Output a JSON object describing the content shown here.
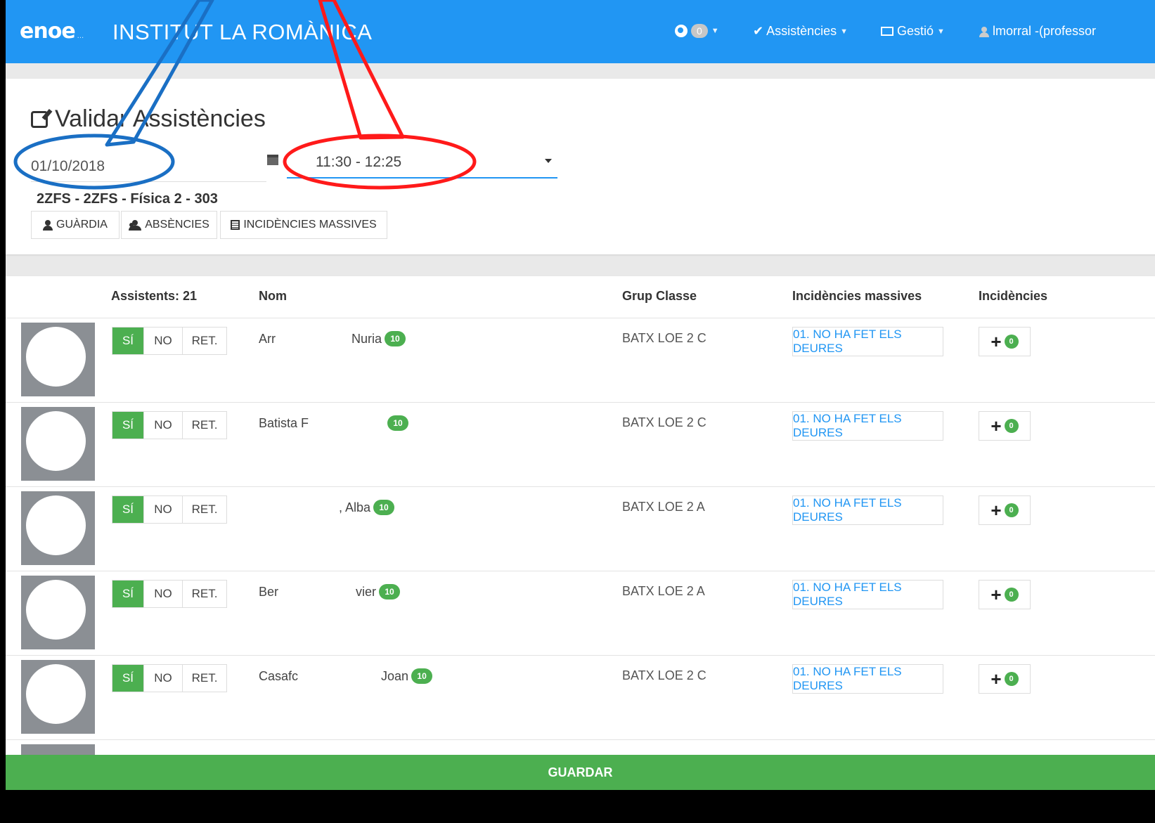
{
  "nav": {
    "logo": "enoe",
    "logo_tail": "...",
    "app_title": "INSTITUT LA ROMÀNICA",
    "notifications_count": "0",
    "assistencies_label": "✔ Assistències",
    "gestio_label": "Gestió",
    "user_label": "lmorral -(professor"
  },
  "header": {
    "title": "Validar Assistències",
    "date_value": "01/10/2018",
    "time_value": "11:30 - 12:25",
    "group_line": "2ZFS - 2ZFS - Física 2 - 303",
    "buttons": {
      "guardia": "GUÀRDIA",
      "absencies": "ABSÈNCIES",
      "incidencies_massives": "INCIDÈNCIES MASSIVES"
    }
  },
  "table": {
    "assistents_header": "Assistents: 21",
    "col_nom": "Nom",
    "col_grup": "Grup Classe",
    "col_massives": "Incidències massives",
    "col_incidencies": "Incidències",
    "attendance_labels": {
      "si": "SÍ",
      "no": "NO",
      "ret": "RET."
    },
    "rows": [
      {
        "name_start": "Arr",
        "name_end": "Nuria",
        "badge": "10",
        "grup": "BATX LOE 2 C",
        "mass": "01. NO HA FET ELS DEURES",
        "count": "0"
      },
      {
        "name_start": "Batista F",
        "name_end": "",
        "badge": "10",
        "grup": "BATX LOE 2 C",
        "mass": "01. NO HA FET ELS DEURES",
        "count": "0"
      },
      {
        "name_start": "",
        "name_end": ", Alba",
        "badge": "10",
        "grup": "BATX LOE 2 A",
        "mass": "01. NO HA FET ELS DEURES",
        "count": "0"
      },
      {
        "name_start": "Ber",
        "name_end": "vier",
        "badge": "10",
        "grup": "BATX LOE 2 A",
        "mass": "01. NO HA FET ELS DEURES",
        "count": "0"
      },
      {
        "name_start": "Casafc",
        "name_end": "Joan",
        "badge": "10",
        "grup": "BATX LOE 2 C",
        "mass": "01. NO HA FET ELS DEURES",
        "count": "0"
      }
    ]
  },
  "save_label": "GUARDAR",
  "colors": {
    "primary": "#2196f3",
    "success": "#4caf50",
    "annotation_blue": "#1a6fc4",
    "annotation_red": "#ff1a1a"
  }
}
